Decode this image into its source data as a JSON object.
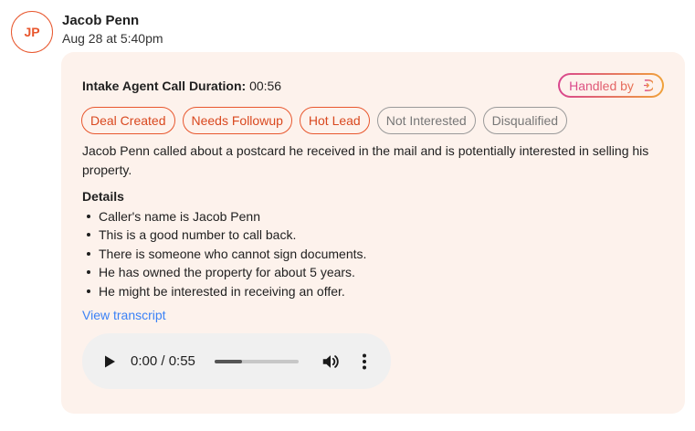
{
  "author": {
    "initials": "JP",
    "name": "Jacob Penn",
    "timestamp": "Aug 28 at 5:40pm"
  },
  "call": {
    "duration_label": "Intake Agent Call Duration:",
    "duration_value": "00:56"
  },
  "handled_badge": {
    "label": "Handled by",
    "icon": "agent-logo-icon"
  },
  "tags": [
    {
      "label": "Deal Created",
      "active": true
    },
    {
      "label": "Needs Followup",
      "active": true
    },
    {
      "label": "Hot Lead",
      "active": true
    },
    {
      "label": "Not Interested",
      "active": false
    },
    {
      "label": "Disqualified",
      "active": false
    }
  ],
  "summary": "Jacob Penn called about a postcard he received in the mail and is potentially interested in selling his property.",
  "details": {
    "heading": "Details",
    "items": [
      "Caller's name is Jacob Penn",
      "This is a good number to call back.",
      "There is someone who cannot sign documents.",
      "He has owned the property for about 5 years.",
      "He might be interested in receiving an offer."
    ]
  },
  "view_transcript_label": "View transcript",
  "audio": {
    "time": "0:00 / 0:55",
    "progress_fraction": 0.33,
    "icons": [
      "play-icon",
      "volume-icon",
      "more-vertical-icon"
    ]
  },
  "colors": {
    "accent": "#e8572e",
    "card_bg": "#fdf2ec",
    "link": "#3b82f6",
    "inactive_tag": "#9a9a9a"
  }
}
